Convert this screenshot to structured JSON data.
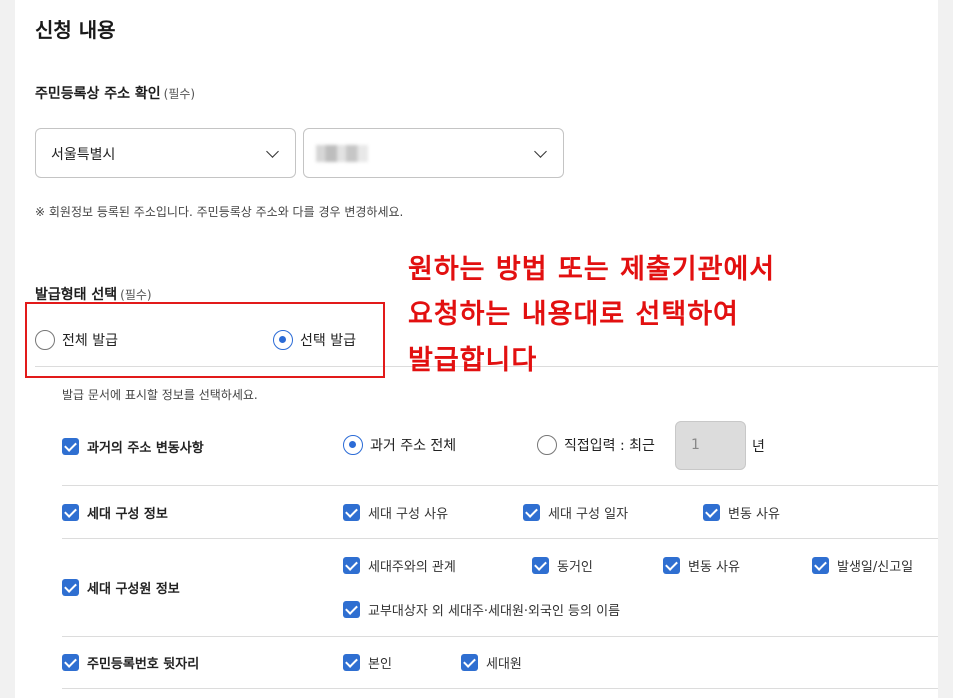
{
  "section_title": "신청 내용",
  "address": {
    "label": "주민등록상 주소 확인",
    "required": "(필수)",
    "city": "서울특별시",
    "note": "※ 회원정보 등록된 주소입니다. 주민등록상 주소와 다를 경우 변경하세요."
  },
  "issue_type": {
    "label": "발급형태 선택",
    "required": "(필수)",
    "options": [
      "전체 발급",
      "선택 발급"
    ],
    "selected": "선택 발급",
    "hint": "발급 문서에 표시할 정보를 선택하세요."
  },
  "annotation": {
    "line1": "원하는 방법 또는 제출기관에서",
    "line2": "요청하는 내용대로 선택하여",
    "line3": "발급합니다"
  },
  "rows": {
    "address_history": {
      "label": "과거의 주소 변동사항",
      "options": [
        "과거 주소 전체",
        "직접입력 : 최근"
      ],
      "selected": "과거 주소 전체",
      "years_value": "1",
      "years_unit": "년"
    },
    "household": {
      "label": "세대 구성 정보",
      "items": [
        "세대 구성 사유",
        "세대 구성 일자",
        "변동 사유"
      ]
    },
    "members": {
      "label": "세대 구성원 정보",
      "items": [
        "세대주와의 관계",
        "동거인",
        "변동 사유",
        "발생일/신고일",
        "교부대상자 외 세대주·세대원·외국인 등의 이름"
      ]
    },
    "resident_no": {
      "label": "주민등록번호 뒷자리",
      "items": [
        "본인",
        "세대원"
      ]
    }
  },
  "colors": {
    "accent": "#2f6fd1",
    "annotation_red": "#e21010",
    "background": "#f1f1f1"
  }
}
